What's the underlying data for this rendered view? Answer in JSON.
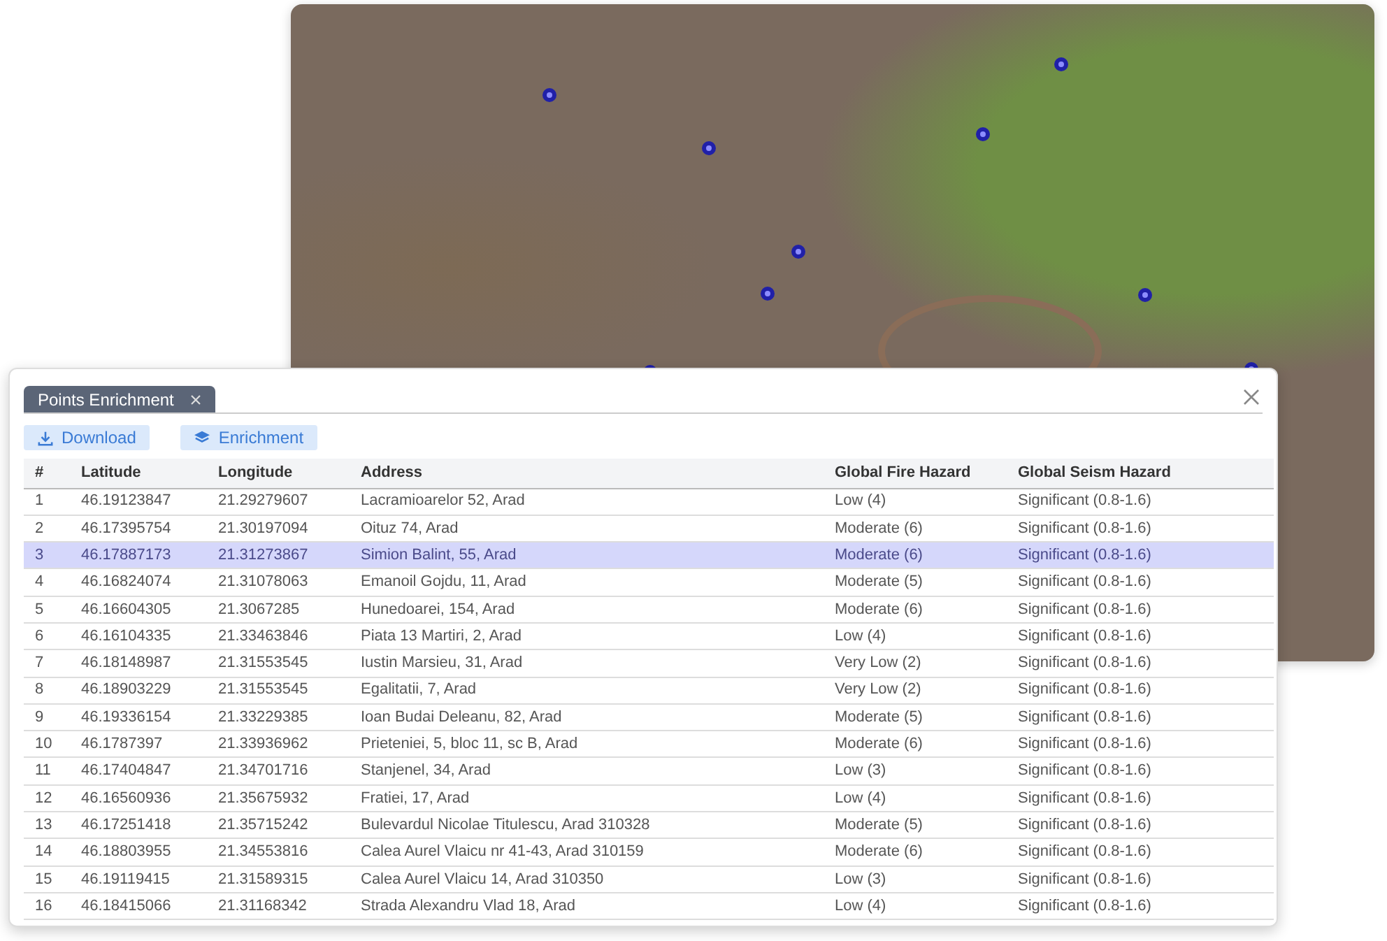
{
  "panel": {
    "tab": {
      "label": "Points Enrichment",
      "selected": true
    },
    "buttons": [
      {
        "kind": "download",
        "label": "Download"
      },
      {
        "kind": "layers",
        "label": "Enrichment"
      }
    ],
    "table": {
      "columns": [
        "#",
        "Latitude",
        "Longitude",
        "Address",
        "Global Fire Hazard",
        "Global Seism Hazard"
      ],
      "rows": [
        {
          "cells": [
            "1",
            "46.19123847",
            "21.29279607",
            "Lacramioarelor 52, Arad",
            "Low (4)",
            "Significant (0.8-1.6)"
          ],
          "selected": false
        },
        {
          "cells": [
            "2",
            "46.17395754",
            "21.30197094",
            "Oituz 74, Arad",
            "Moderate (6)",
            "Significant (0.8-1.6)"
          ],
          "selected": false
        },
        {
          "cells": [
            "3",
            "46.17887173",
            "21.31273867",
            "Simion Balint, 55, Arad",
            "Moderate (6)",
            "Significant (0.8-1.6)"
          ],
          "selected": true
        },
        {
          "cells": [
            "4",
            "46.16824074",
            "21.31078063",
            "Emanoil Gojdu, 11, Arad",
            "Moderate (5)",
            "Significant (0.8-1.6)"
          ],
          "selected": false
        },
        {
          "cells": [
            "5",
            "46.16604305",
            "21.3067285",
            "Hunedoarei, 154, Arad",
            "Moderate (6)",
            "Significant (0.8-1.6)"
          ],
          "selected": false
        },
        {
          "cells": [
            "6",
            "46.16104335",
            "21.33463846",
            "Piata 13 Martiri, 2, Arad",
            "Low (4)",
            "Significant (0.8-1.6)"
          ],
          "selected": false
        },
        {
          "cells": [
            "7",
            "46.18148987",
            "21.31553545",
            "Iustin Marsieu, 31, Arad",
            "Very Low (2)",
            "Significant (0.8-1.6)"
          ],
          "selected": false
        },
        {
          "cells": [
            "8",
            "46.18903229",
            "21.31553545",
            "Egalitatii, 7, Arad",
            "Very Low (2)",
            "Significant (0.8-1.6)"
          ],
          "selected": false
        },
        {
          "cells": [
            "9",
            "46.19336154",
            "21.33229385",
            "Ioan Budai Deleanu, 82, Arad",
            "Moderate (5)",
            "Significant (0.8-1.6)"
          ],
          "selected": false
        },
        {
          "cells": [
            "10",
            "46.1787397",
            "21.33936962",
            "Prieteniei, 5, bloc 11, sc B, Arad",
            "Moderate (6)",
            "Significant (0.8-1.6)"
          ],
          "selected": false
        },
        {
          "cells": [
            "11",
            "46.17404847",
            "21.34701716",
            "Stanjenel, 34, Arad",
            "Low (3)",
            "Significant (0.8-1.6)"
          ],
          "selected": false
        },
        {
          "cells": [
            "12",
            "46.16560936",
            "21.35675932",
            "Fratiei, 17, Arad",
            "Low (4)",
            "Significant (0.8-1.6)"
          ],
          "selected": false
        },
        {
          "cells": [
            "13",
            "46.17251418",
            "21.35715242",
            "Bulevardul Nicolae Titulescu, Arad 310328",
            "Moderate (5)",
            "Significant (0.8-1.6)"
          ],
          "selected": false
        },
        {
          "cells": [
            "14",
            "46.18803955",
            "21.34553816",
            "Calea Aurel Vlaicu nr 41-43, Arad 310159",
            "Moderate (6)",
            "Significant (0.8-1.6)"
          ],
          "selected": false
        },
        {
          "cells": [
            "15",
            "46.19119415",
            "21.31589315",
            "Calea Aurel Vlaicu 14, Arad 310350",
            "Low (3)",
            "Significant (0.8-1.6)"
          ],
          "selected": false
        },
        {
          "cells": [
            "16",
            "46.18415066",
            "21.31168342",
            "Strada Alexandru Vlad 18, Arad",
            "Low (4)",
            "Significant (0.8-1.6)"
          ],
          "selected": false
        }
      ]
    }
  }
}
